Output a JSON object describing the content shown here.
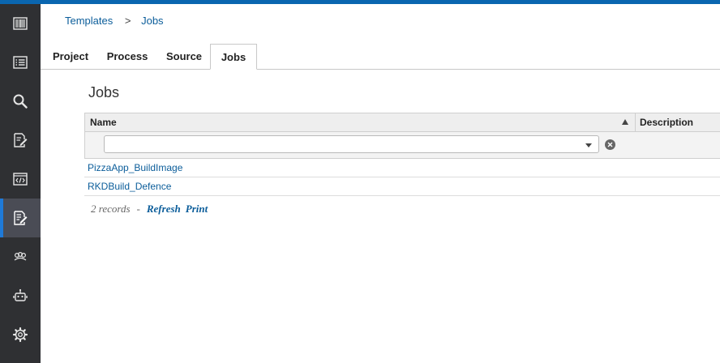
{
  "sidebar": {
    "items": [
      {
        "icon": "barcode-icon"
      },
      {
        "icon": "list-icon"
      },
      {
        "icon": "search-icon"
      },
      {
        "icon": "edit-document-icon"
      },
      {
        "icon": "code-window-icon"
      },
      {
        "icon": "template-edit-icon",
        "active": true
      },
      {
        "icon": "group-icon"
      },
      {
        "icon": "robot-icon"
      },
      {
        "icon": "gear-icon"
      }
    ]
  },
  "breadcrumb": {
    "parent": "Templates",
    "separator": ">",
    "current": "Jobs"
  },
  "tabs": [
    {
      "label": "Project"
    },
    {
      "label": "Process"
    },
    {
      "label": "Source"
    },
    {
      "label": "Jobs",
      "active": true
    }
  ],
  "page": {
    "title": "Jobs"
  },
  "grid": {
    "columns": {
      "name": "Name",
      "description": "Description"
    },
    "filter": {
      "value": "",
      "placeholder": ""
    },
    "rows": [
      {
        "name": "PizzaApp_BuildImage",
        "description": ""
      },
      {
        "name": "RKDBuild_Defence",
        "description": ""
      }
    ]
  },
  "footer": {
    "records": "2 records",
    "dash": "-",
    "refresh": "Refresh",
    "print": "Print"
  },
  "colors": {
    "accent": "#0a66b0",
    "sidebar_bg": "#2f3033",
    "link": "#0b5d9a"
  }
}
